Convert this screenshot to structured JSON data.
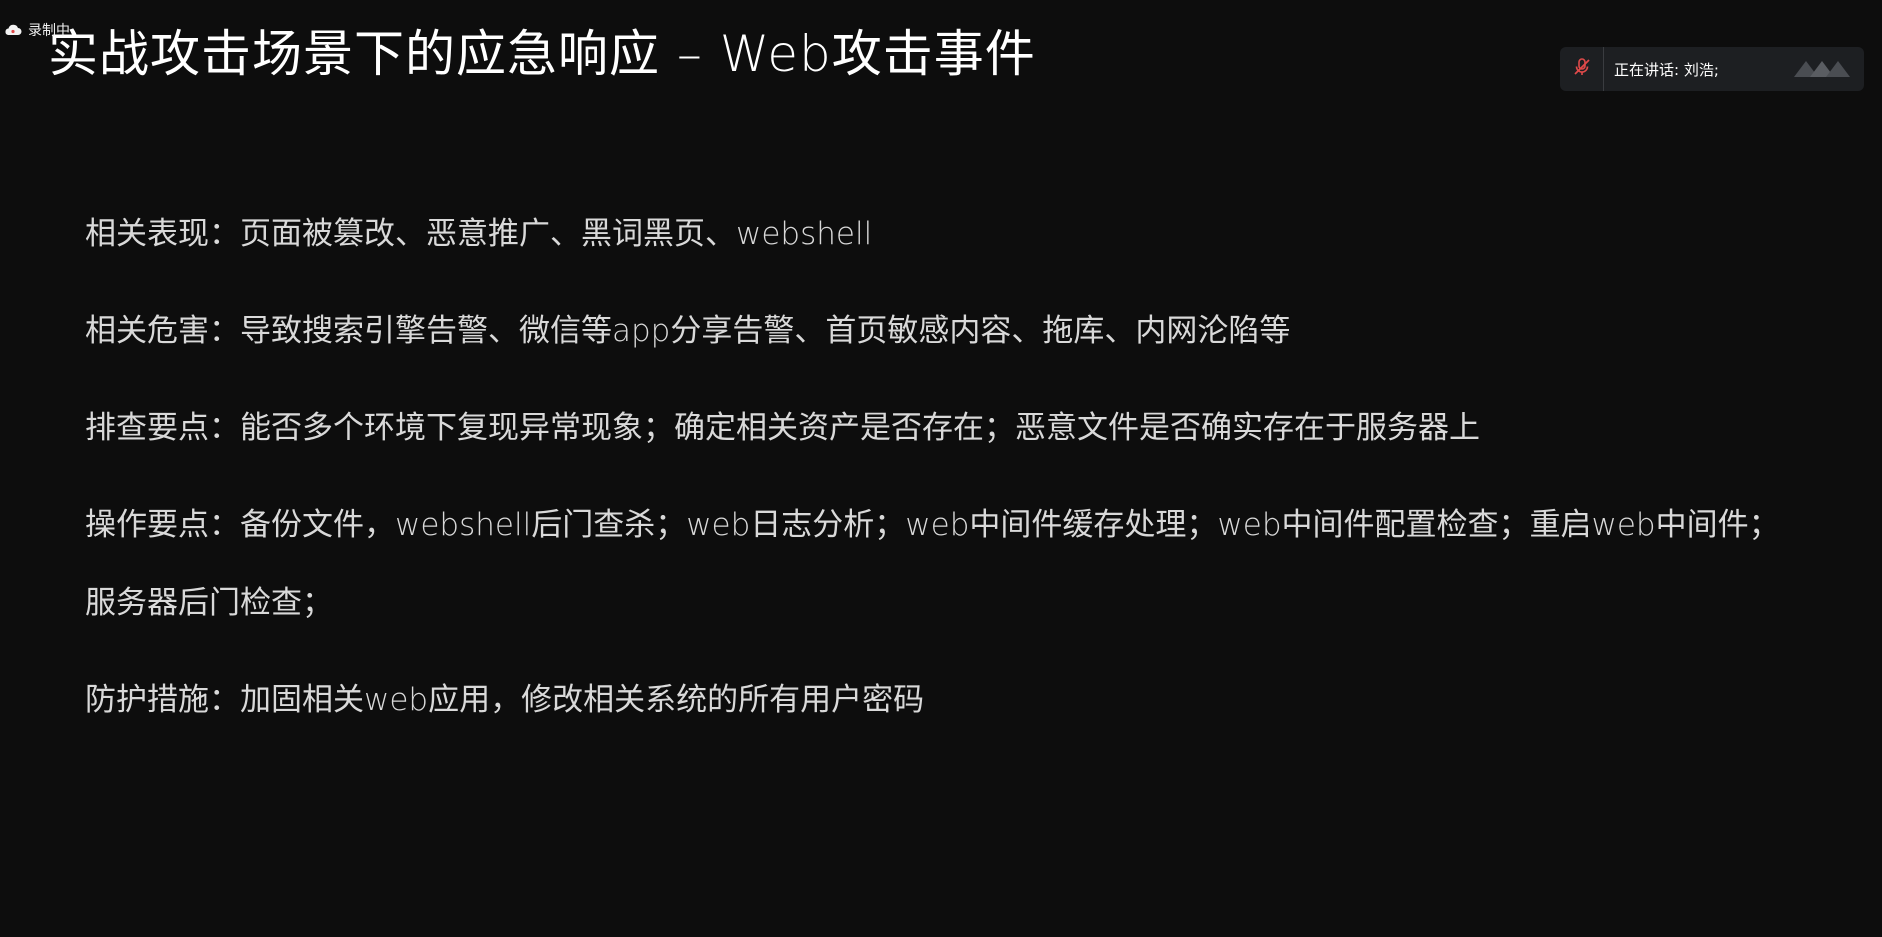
{
  "recording": {
    "label": "录制中"
  },
  "slide": {
    "title": "实战攻击场景下的应急响应 – Web攻击事件",
    "points": [
      {
        "label": "相关表现：",
        "text": "页面被篡改、恶意推广、黑词黑页、webshell"
      },
      {
        "label": "相关危害：",
        "text": "导致搜索引擎告警、微信等app分享告警、首页敏感内容、拖库、内网沦陷等"
      },
      {
        "label": "排查要点：",
        "text": "能否多个环境下复现异常现象；确定相关资产是否存在；恶意文件是否确实存在于服务器上"
      },
      {
        "label": "操作要点：",
        "text": "备份文件，webshell后门查杀；web日志分析；web中间件缓存处理；web中间件配置检查；重启web中间件；",
        "continuation": "服务器后门检查；"
      },
      {
        "label": "防护措施：",
        "text": "加固相关web应用，修改相关系统的所有用户密码"
      }
    ]
  },
  "meeting": {
    "speaking_label": "正在讲话: 刘浩;",
    "mic_icon": "mic-muted-icon",
    "colors": {
      "panel_bg": "#1d1f22",
      "mic_muted": "#e04a4a"
    }
  },
  "colors": {
    "background": "#0d0d0d",
    "title": "#ffffff",
    "body_text": "#d9d9d9"
  }
}
